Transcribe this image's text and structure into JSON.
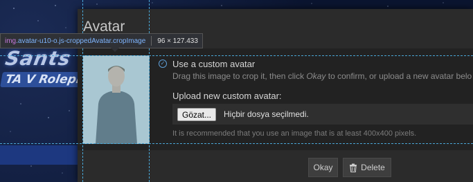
{
  "background": {
    "logo_top": "Sants",
    "logo_bottom": "TA V Roleplay"
  },
  "dialog": {
    "title": "Avatar",
    "option_label": "Use a custom avatar",
    "hint_part1": "Drag this image to crop it, then click ",
    "hint_em": "Okay",
    "hint_part2": " to confirm, or upload a new avatar belo",
    "upload_label": "Upload new custom avatar:",
    "file_button": "Gözat...",
    "file_status": "Hiçbir dosya seçilmedi.",
    "recommend": "It is recommended that you use an image that is at least 400x400 pixels.",
    "ok_label": "Okay",
    "delete_label": "Delete"
  },
  "inspector": {
    "tag": "img",
    "selector": ".avatar-u10-o.js-croppedAvatar.cropImage",
    "size": "96 × 127.433"
  },
  "colors": {
    "guide": "#4aa8d8",
    "accent": "#5e9fd8"
  }
}
